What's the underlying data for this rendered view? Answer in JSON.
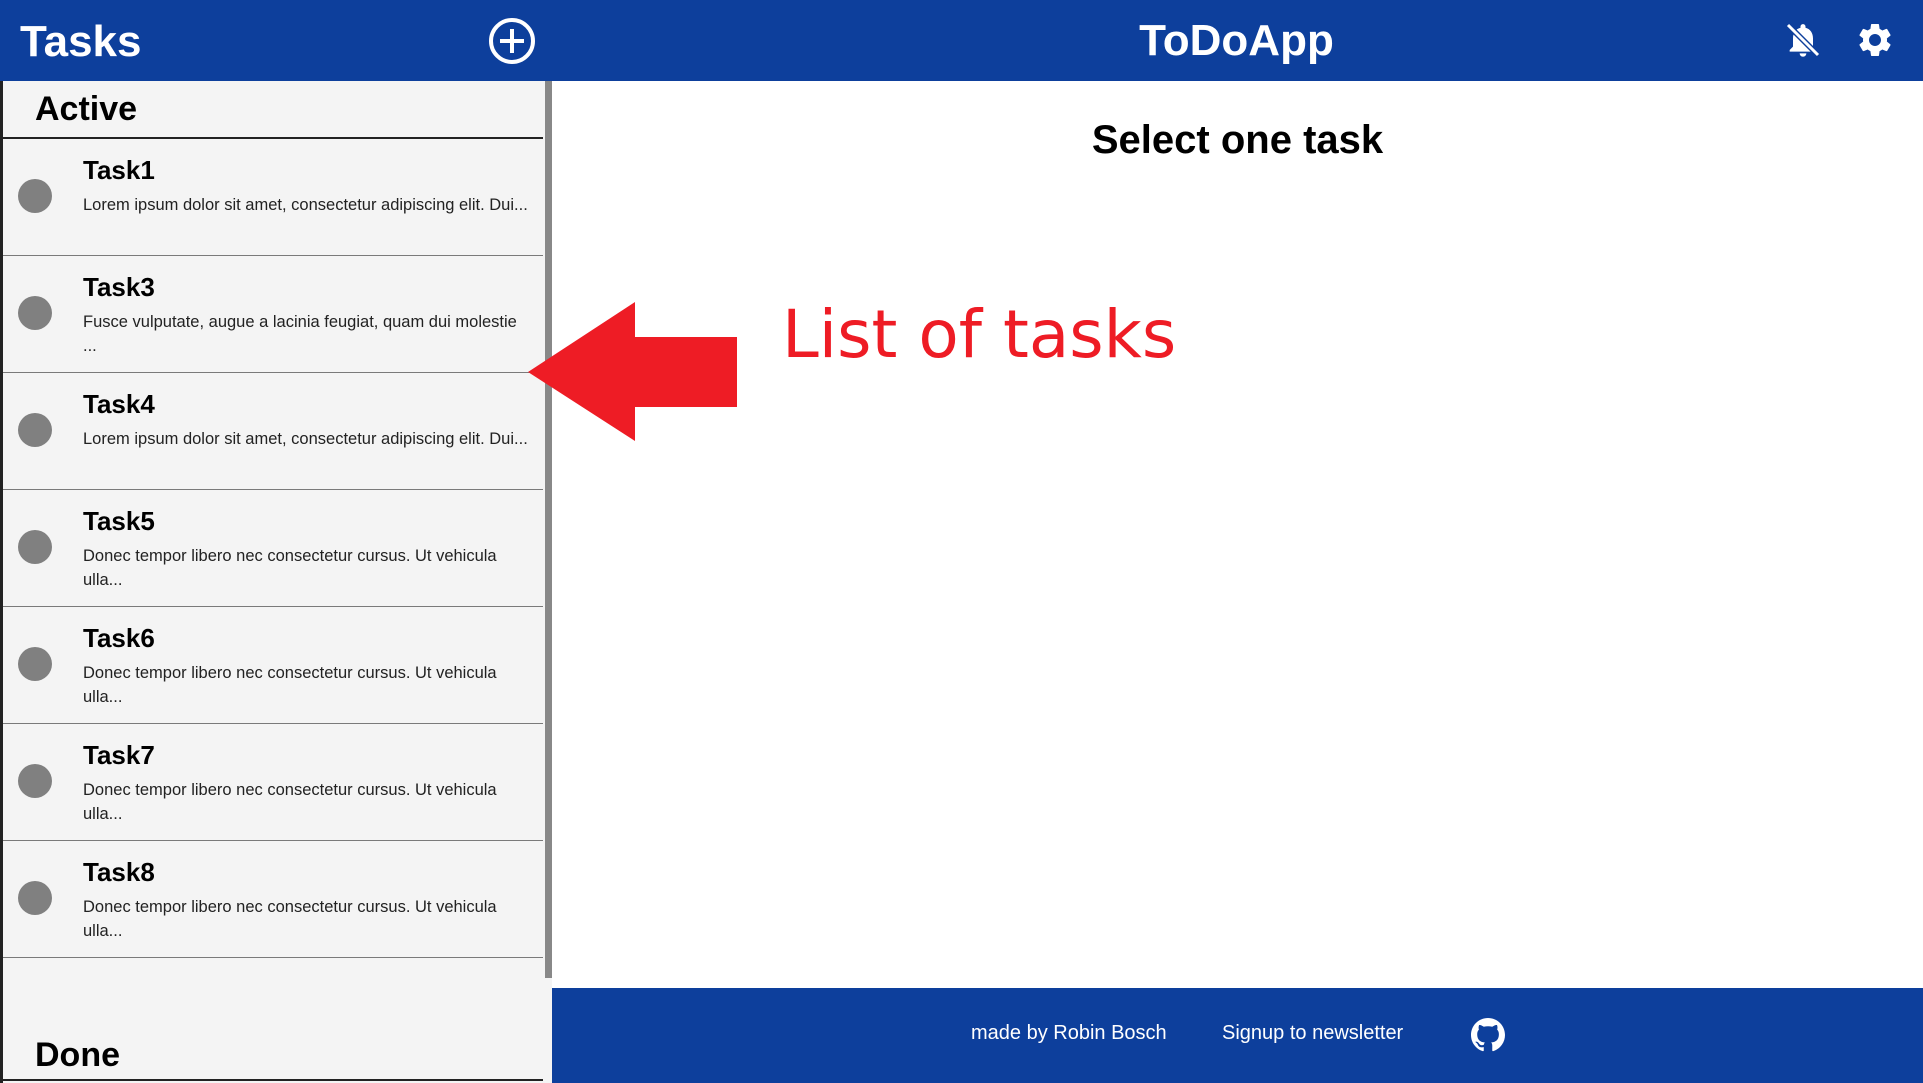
{
  "sidebar": {
    "title": "Tasks",
    "add_icon": "plus-circle-icon",
    "sections": {
      "active": "Active",
      "done": "Done"
    },
    "tasks": [
      {
        "name": "Task1",
        "desc": "Lorem ipsum dolor sit amet, consectetur adipiscing elit. Dui..."
      },
      {
        "name": "Task3",
        "desc": "Fusce vulputate, augue a lacinia feugiat, quam dui molestie ..."
      },
      {
        "name": "Task4",
        "desc": "Lorem ipsum dolor sit amet, consectetur adipiscing elit. Dui..."
      },
      {
        "name": "Task5",
        "desc": "Donec tempor libero nec consectetur cursus. Ut vehicula ulla..."
      },
      {
        "name": "Task6",
        "desc": "Donec tempor libero nec consectetur cursus. Ut vehicula ulla..."
      },
      {
        "name": "Task7",
        "desc": "Donec tempor libero nec consectetur cursus. Ut vehicula ulla..."
      },
      {
        "name": "Task8",
        "desc": "Donec tempor libero nec consectetur cursus. Ut vehicula ulla..."
      }
    ]
  },
  "header": {
    "app_title": "ToDoApp",
    "icons": [
      "bell-off-icon",
      "gear-icon"
    ]
  },
  "main": {
    "placeholder": "Select one task"
  },
  "annotation": {
    "text": "List of tasks",
    "color": "#ee1c25"
  },
  "footer": {
    "credit": "made by Robin Bosch",
    "newsletter": "Signup to newsletter",
    "github_icon": "github-icon"
  },
  "colors": {
    "brand": "#0d3f9c",
    "sidebar_bg": "#f4f4f4",
    "task_dot": "#808080"
  }
}
